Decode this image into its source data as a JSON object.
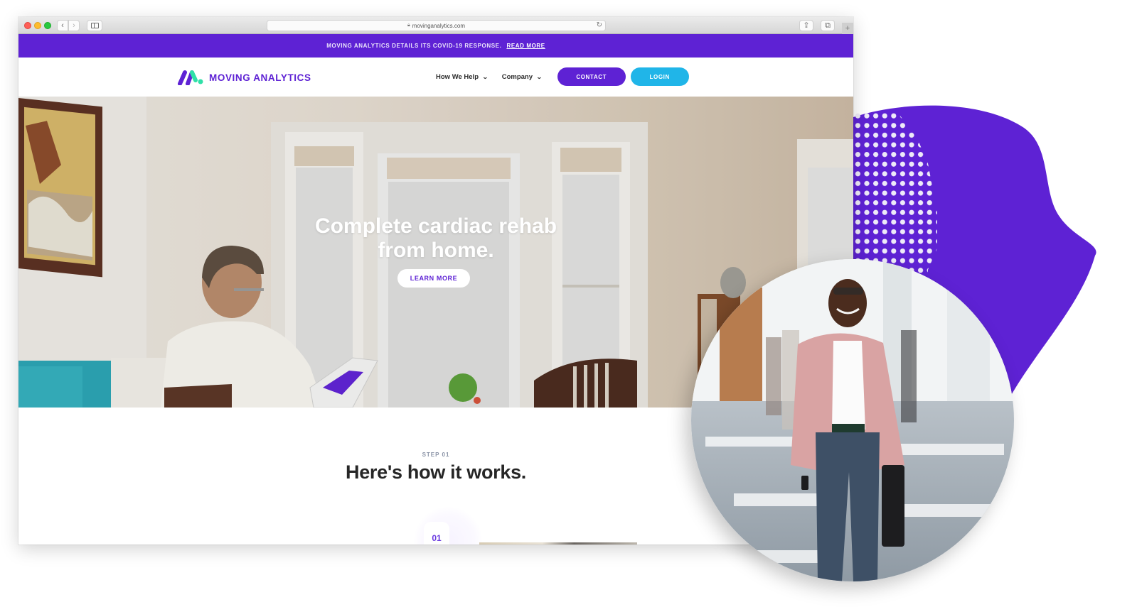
{
  "browser": {
    "url": "movinganalytics.com",
    "nav_back_icon": "‹",
    "nav_forward_icon": "›",
    "reload_icon": "↻",
    "share_icon": "⇪",
    "tabs_icon": "⧉",
    "new_tab_icon": "+"
  },
  "announcement": {
    "text": "MOVING ANALYTICS DETAILS ITS COVID-19 RESPONSE.",
    "link_label": "READ MORE"
  },
  "header": {
    "brand_name": "MOVING ANALYTICS",
    "nav": [
      {
        "label": "How We Help",
        "chevron": "⌄"
      },
      {
        "label": "Company",
        "chevron": "⌄"
      }
    ],
    "contact_label": "CONTACT",
    "login_label": "LOGIN"
  },
  "hero": {
    "title_line1": "Complete cardiac rehab",
    "title_line2": "from home.",
    "cta_label": "LEARN MORE"
  },
  "how_it_works": {
    "step_label": "STEP 01",
    "heading": "Here's how it works.",
    "step_number": "01"
  },
  "colors": {
    "brand_purple": "#5e22d4",
    "login_blue": "#20b5e8",
    "logo_green": "#2fe0a8",
    "heading_dark": "#262626"
  }
}
